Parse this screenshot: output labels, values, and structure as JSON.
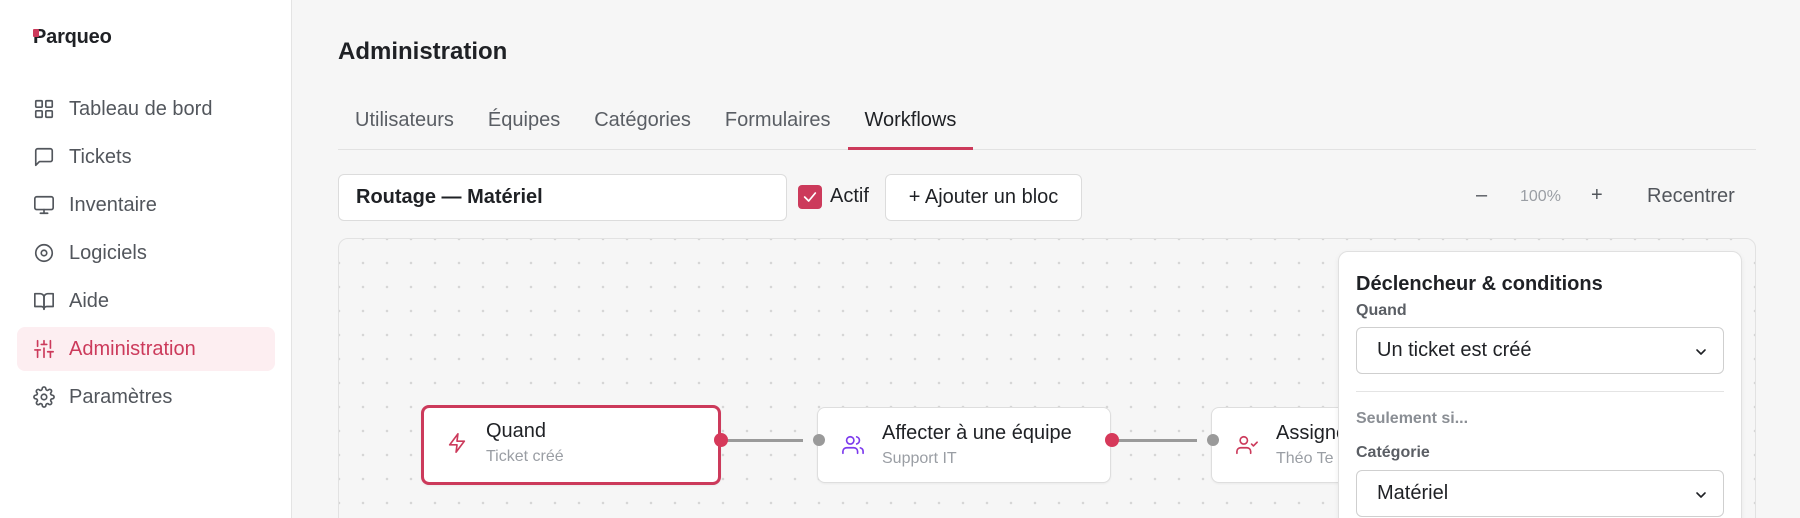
{
  "app": {
    "logo": "Parqueo",
    "brand_color": "#cc3a5b"
  },
  "sidebar": {
    "items": [
      {
        "label": "Tableau de bord",
        "icon": "grid-icon"
      },
      {
        "label": "Tickets",
        "icon": "message-square-icon"
      },
      {
        "label": "Inventaire",
        "icon": "monitor-icon"
      },
      {
        "label": "Logiciels",
        "icon": "disc-icon"
      },
      {
        "label": "Aide",
        "icon": "book-open-icon"
      },
      {
        "label": "Administration",
        "icon": "sliders-icon",
        "active": true
      },
      {
        "label": "Paramètres",
        "icon": "settings-gear-icon"
      }
    ]
  },
  "header": {
    "title": "Administration"
  },
  "tabs": [
    {
      "label": "Utilisateurs"
    },
    {
      "label": "Équipes"
    },
    {
      "label": "Catégories"
    },
    {
      "label": "Formulaires"
    },
    {
      "label": "Workflows",
      "active": true
    }
  ],
  "toolbar": {
    "workflow_name": "Routage — Matériel",
    "active_label": "Actif",
    "active_checked": true,
    "add_block_label": "+ Ajouter un bloc",
    "zoom_minus": "–",
    "zoom_level": "100%",
    "zoom_plus": "+",
    "recenter_label": "Recentrer"
  },
  "canvas": {
    "nodes": [
      {
        "title": "Quand",
        "subtitle": "Ticket créé",
        "icon": "zap-icon",
        "icon_color": "#cc3a5b",
        "selected": true
      },
      {
        "title": "Affecter à une équipe",
        "subtitle": "Support IT",
        "icon": "users-icon",
        "icon_color": "#7c3aed"
      },
      {
        "title": "Assigner",
        "subtitle": "Théo Te",
        "icon": "user-check-icon",
        "icon_color": "#cc3a5b"
      }
    ]
  },
  "panel": {
    "title": "Déclencheur & conditions",
    "when_label": "Quand",
    "when_value": "Un ticket est créé",
    "only_if_label": "Seulement si...",
    "category_label": "Catégorie",
    "category_value": "Matériel"
  }
}
